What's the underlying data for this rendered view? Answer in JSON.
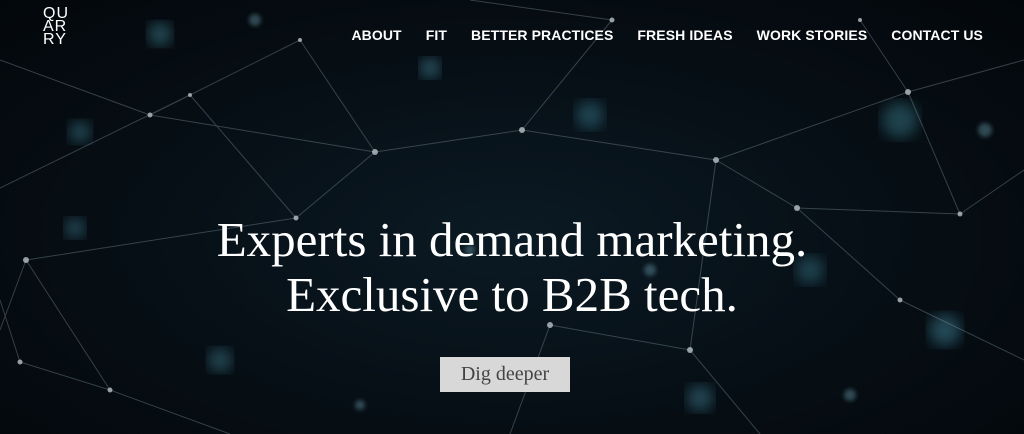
{
  "logo": {
    "lines": [
      "QU",
      "AR",
      "RY"
    ]
  },
  "nav": {
    "items": [
      "ABOUT",
      "FIT",
      "BETTER PRACTICES",
      "FRESH IDEAS",
      "WORK STORIES",
      "CONTACT US"
    ]
  },
  "hero": {
    "headline_line1": "Experts in demand marketing.",
    "headline_line2": "Exclusive to B2B tech.",
    "cta_label": "Dig deeper"
  },
  "colors": {
    "background": "#05090f",
    "text": "#ffffff",
    "button_background": "#d8d8d8",
    "button_text": "#444444"
  }
}
